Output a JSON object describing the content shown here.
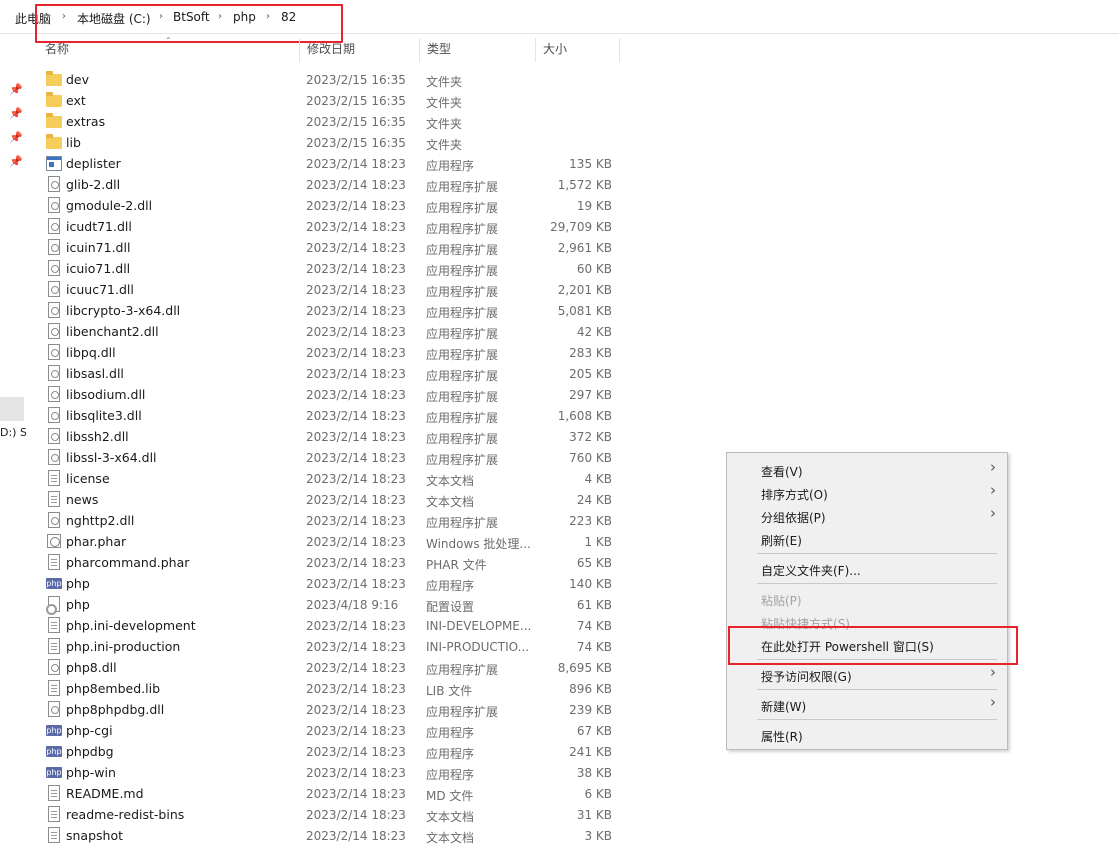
{
  "breadcrumb": [
    "此电脑",
    "本地磁盘 (C:)",
    "BtSoft",
    "php",
    "82"
  ],
  "nav": {
    "partial_label": "D:) S"
  },
  "columns": {
    "name": "名称",
    "modified": "修改日期",
    "type": "类型",
    "size": "大小"
  },
  "files": [
    {
      "name": "dev",
      "date": "2023/2/15 16:35",
      "type": "文件夹",
      "size": "",
      "icon": "folder-icon"
    },
    {
      "name": "ext",
      "date": "2023/2/15 16:35",
      "type": "文件夹",
      "size": "",
      "icon": "folder-icon"
    },
    {
      "name": "extras",
      "date": "2023/2/15 16:35",
      "type": "文件夹",
      "size": "",
      "icon": "folder-icon"
    },
    {
      "name": "lib",
      "date": "2023/2/15 16:35",
      "type": "文件夹",
      "size": "",
      "icon": "folder-icon"
    },
    {
      "name": "deplister",
      "date": "2023/2/14 18:23",
      "type": "应用程序",
      "size": "135 KB",
      "icon": "application-icon"
    },
    {
      "name": "glib-2.dll",
      "date": "2023/2/14 18:23",
      "type": "应用程序扩展",
      "size": "1,572 KB",
      "icon": "dll-icon"
    },
    {
      "name": "gmodule-2.dll",
      "date": "2023/2/14 18:23",
      "type": "应用程序扩展",
      "size": "19 KB",
      "icon": "dll-icon"
    },
    {
      "name": "icudt71.dll",
      "date": "2023/2/14 18:23",
      "type": "应用程序扩展",
      "size": "29,709 KB",
      "icon": "dll-icon"
    },
    {
      "name": "icuin71.dll",
      "date": "2023/2/14 18:23",
      "type": "应用程序扩展",
      "size": "2,961 KB",
      "icon": "dll-icon"
    },
    {
      "name": "icuio71.dll",
      "date": "2023/2/14 18:23",
      "type": "应用程序扩展",
      "size": "60 KB",
      "icon": "dll-icon"
    },
    {
      "name": "icuuc71.dll",
      "date": "2023/2/14 18:23",
      "type": "应用程序扩展",
      "size": "2,201 KB",
      "icon": "dll-icon"
    },
    {
      "name": "libcrypto-3-x64.dll",
      "date": "2023/2/14 18:23",
      "type": "应用程序扩展",
      "size": "5,081 KB",
      "icon": "dll-icon"
    },
    {
      "name": "libenchant2.dll",
      "date": "2023/2/14 18:23",
      "type": "应用程序扩展",
      "size": "42 KB",
      "icon": "dll-icon"
    },
    {
      "name": "libpq.dll",
      "date": "2023/2/14 18:23",
      "type": "应用程序扩展",
      "size": "283 KB",
      "icon": "dll-icon"
    },
    {
      "name": "libsasl.dll",
      "date": "2023/2/14 18:23",
      "type": "应用程序扩展",
      "size": "205 KB",
      "icon": "dll-icon"
    },
    {
      "name": "libsodium.dll",
      "date": "2023/2/14 18:23",
      "type": "应用程序扩展",
      "size": "297 KB",
      "icon": "dll-icon"
    },
    {
      "name": "libsqlite3.dll",
      "date": "2023/2/14 18:23",
      "type": "应用程序扩展",
      "size": "1,608 KB",
      "icon": "dll-icon"
    },
    {
      "name": "libssh2.dll",
      "date": "2023/2/14 18:23",
      "type": "应用程序扩展",
      "size": "372 KB",
      "icon": "dll-icon"
    },
    {
      "name": "libssl-3-x64.dll",
      "date": "2023/2/14 18:23",
      "type": "应用程序扩展",
      "size": "760 KB",
      "icon": "dll-icon"
    },
    {
      "name": "license",
      "date": "2023/2/14 18:23",
      "type": "文本文档",
      "size": "4 KB",
      "icon": "text-document-icon"
    },
    {
      "name": "news",
      "date": "2023/2/14 18:23",
      "type": "文本文档",
      "size": "24 KB",
      "icon": "text-document-icon"
    },
    {
      "name": "nghttp2.dll",
      "date": "2023/2/14 18:23",
      "type": "应用程序扩展",
      "size": "223 KB",
      "icon": "dll-icon"
    },
    {
      "name": "phar.phar",
      "date": "2023/2/14 18:23",
      "type": "Windows 批处理...",
      "size": "1 KB",
      "icon": "phar-icon"
    },
    {
      "name": "pharcommand.phar",
      "date": "2023/2/14 18:23",
      "type": "PHAR 文件",
      "size": "65 KB",
      "icon": "text-document-icon"
    },
    {
      "name": "php",
      "date": "2023/2/14 18:23",
      "type": "应用程序",
      "size": "140 KB",
      "icon": "php-icon"
    },
    {
      "name": "php",
      "date": "2023/4/18 9:16",
      "type": "配置设置",
      "size": "61 KB",
      "icon": "settings-file-icon"
    },
    {
      "name": "php.ini-development",
      "date": "2023/2/14 18:23",
      "type": "INI-DEVELOPME...",
      "size": "74 KB",
      "icon": "text-document-icon"
    },
    {
      "name": "php.ini-production",
      "date": "2023/2/14 18:23",
      "type": "INI-PRODUCTIO...",
      "size": "74 KB",
      "icon": "text-document-icon"
    },
    {
      "name": "php8.dll",
      "date": "2023/2/14 18:23",
      "type": "应用程序扩展",
      "size": "8,695 KB",
      "icon": "dll-icon"
    },
    {
      "name": "php8embed.lib",
      "date": "2023/2/14 18:23",
      "type": "LIB 文件",
      "size": "896 KB",
      "icon": "text-document-icon"
    },
    {
      "name": "php8phpdbg.dll",
      "date": "2023/2/14 18:23",
      "type": "应用程序扩展",
      "size": "239 KB",
      "icon": "dll-icon"
    },
    {
      "name": "php-cgi",
      "date": "2023/2/14 18:23",
      "type": "应用程序",
      "size": "67 KB",
      "icon": "php-icon"
    },
    {
      "name": "phpdbg",
      "date": "2023/2/14 18:23",
      "type": "应用程序",
      "size": "241 KB",
      "icon": "php-icon"
    },
    {
      "name": "php-win",
      "date": "2023/2/14 18:23",
      "type": "应用程序",
      "size": "38 KB",
      "icon": "php-icon"
    },
    {
      "name": "README.md",
      "date": "2023/2/14 18:23",
      "type": "MD 文件",
      "size": "6 KB",
      "icon": "text-document-icon"
    },
    {
      "name": "readme-redist-bins",
      "date": "2023/2/14 18:23",
      "type": "文本文档",
      "size": "31 KB",
      "icon": "text-document-icon"
    },
    {
      "name": "snapshot",
      "date": "2023/2/14 18:23",
      "type": "文本文档",
      "size": "3 KB",
      "icon": "text-document-icon"
    }
  ],
  "context_menu": {
    "view": "查看(V)",
    "sort_by": "排序方式(O)",
    "group_by": "分组依据(P)",
    "refresh": "刷新(E)",
    "customize_folder": "自定义文件夹(F)...",
    "paste": "粘贴(P)",
    "paste_shortcut": "粘贴快捷方式(S)",
    "open_powershell": "在此处打开 Powershell 窗口(S)",
    "give_access": "授予访问权限(G)",
    "new": "新建(W)",
    "properties": "属性(R)"
  },
  "colors": {
    "highlight_border": "#e8232d",
    "menu_background": "#f0f0f0",
    "folder": "#f6cd5a"
  }
}
